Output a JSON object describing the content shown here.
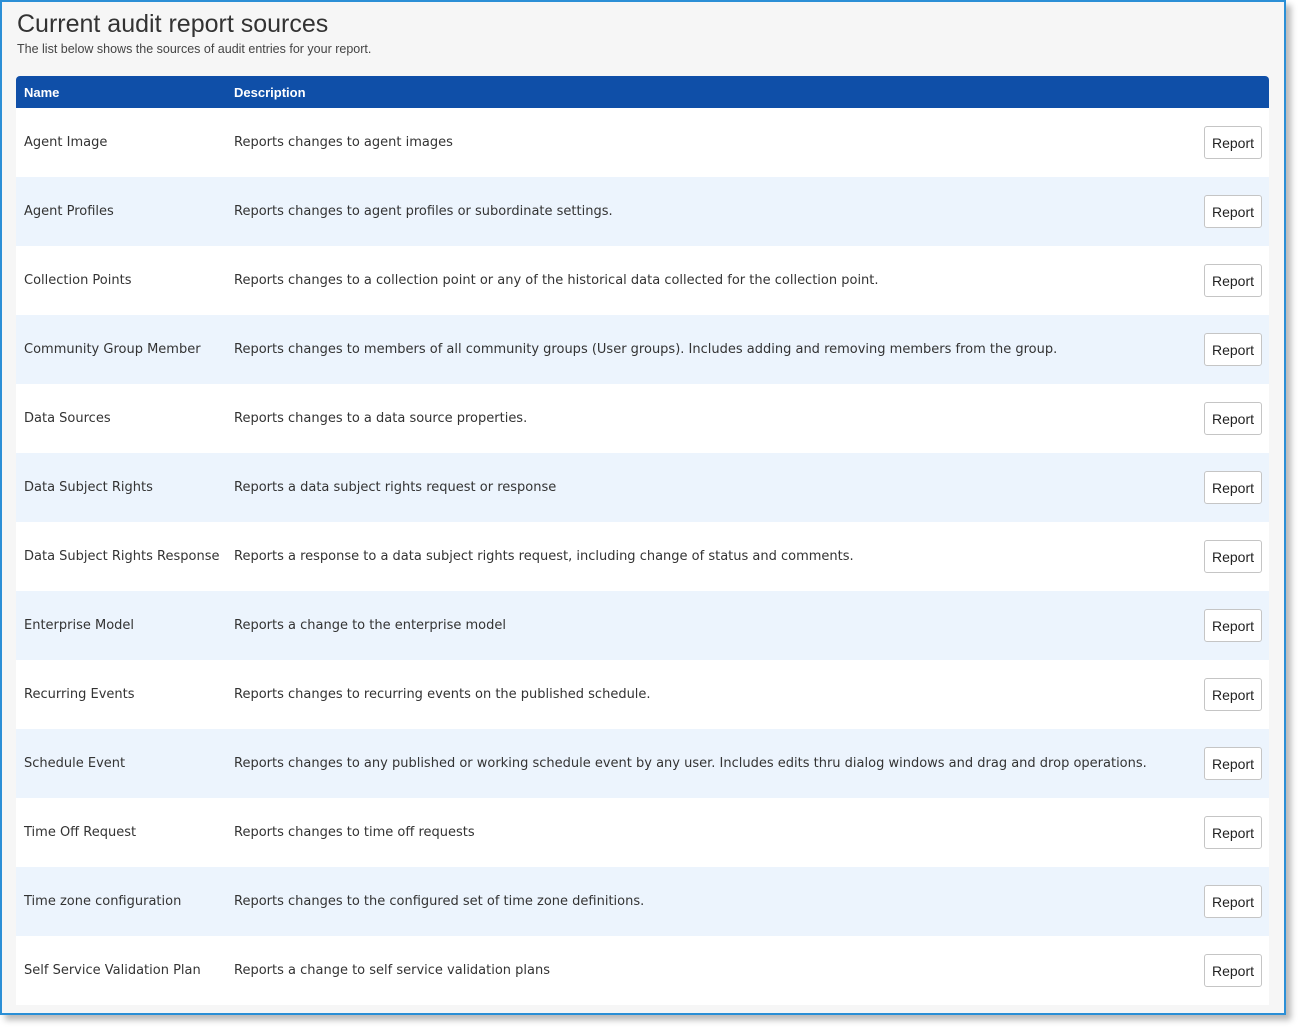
{
  "page": {
    "title": "Current audit report sources",
    "subtitle": "The list below shows the sources of audit entries for your report."
  },
  "table": {
    "columns": {
      "name": "Name",
      "description": "Description"
    },
    "action_label": "Report",
    "rows": [
      {
        "name": "Agent Image",
        "description": "Reports changes to agent images"
      },
      {
        "name": "Agent Profiles",
        "description": "Reports changes to agent profiles or subordinate settings."
      },
      {
        "name": "Collection Points",
        "description": "Reports changes to a collection point or any of the historical data collected for the collection point."
      },
      {
        "name": "Community Group Member",
        "description": "Reports changes to members of all community groups (User groups). Includes adding and removing members from the group."
      },
      {
        "name": "Data Sources",
        "description": "Reports changes to a data source properties."
      },
      {
        "name": "Data Subject Rights",
        "description": "Reports a data subject rights request or response"
      },
      {
        "name": "Data Subject Rights Response",
        "description": "Reports a response to a data subject rights request, including change of status and comments."
      },
      {
        "name": "Enterprise Model",
        "description": "Reports a change to the enterprise model"
      },
      {
        "name": "Recurring Events",
        "description": "Reports changes to recurring events on the published schedule."
      },
      {
        "name": "Schedule Event",
        "description": "Reports changes to any published or working schedule event by any user. Includes edits thru dialog windows and drag and drop operations."
      },
      {
        "name": "Time Off Request",
        "description": "Reports changes to time off requests"
      },
      {
        "name": "Time zone configuration",
        "description": "Reports changes to the configured set of time zone definitions."
      },
      {
        "name": "Self Service Validation Plan",
        "description": "Reports a change to self service validation plans"
      }
    ]
  },
  "colors": {
    "header_bg": "#0f4fa8",
    "row_alt_bg": "#ecf4fd",
    "frame_border": "#2b8fd6"
  }
}
